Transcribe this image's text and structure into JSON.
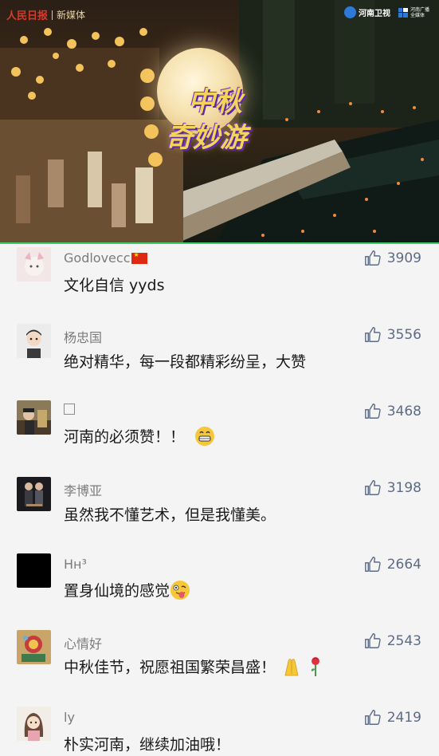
{
  "video": {
    "brand_left": "人民日报",
    "brand_left_sub": "新媒体",
    "channel_logo": "河南卫视",
    "media_logo_line1": "河南广播",
    "media_logo_line2": "全媒体",
    "show_title_line1": "中秋",
    "show_title_line2": "奇妙游",
    "progress_fraction": 1.0
  },
  "comments": [
    {
      "name": "Godlovecc",
      "badge": "china-flag-icon",
      "text": "文化自信 yyds",
      "likes": "3909",
      "emoji": ""
    },
    {
      "name": "杨忠国",
      "badge": "",
      "text": "绝对精华，每一段都精彩纷呈，大赞",
      "likes": "3556",
      "emoji": ""
    },
    {
      "name": "",
      "badge": "empty-box-icon",
      "text": "河南的必须赞！！",
      "likes": "3468",
      "emoji": "grinning-face-icon"
    },
    {
      "name": "李博亚",
      "badge": "",
      "text": "虽然我不懂艺术，但是我懂美。",
      "likes": "3198",
      "emoji": ""
    },
    {
      "name": "Hʜ³",
      "badge": "",
      "text": "置身仙境的感觉",
      "likes": "2664",
      "emoji": "tongue-face-icon"
    },
    {
      "name": "心情好",
      "badge": "",
      "text": "中秋佳节，祝愿祖国繁荣昌盛！",
      "likes": "2543",
      "emoji": "folded-hands-rose-icon"
    },
    {
      "name": "ly",
      "badge": "",
      "text": "朴实河南，继续加油哦！",
      "likes": "2419",
      "emoji": ""
    }
  ],
  "colors": {
    "like_color": "#5d6b86",
    "name_color": "#7b7b7b",
    "background": "#f4f4f4",
    "progress_color": "#3fcf6a"
  }
}
